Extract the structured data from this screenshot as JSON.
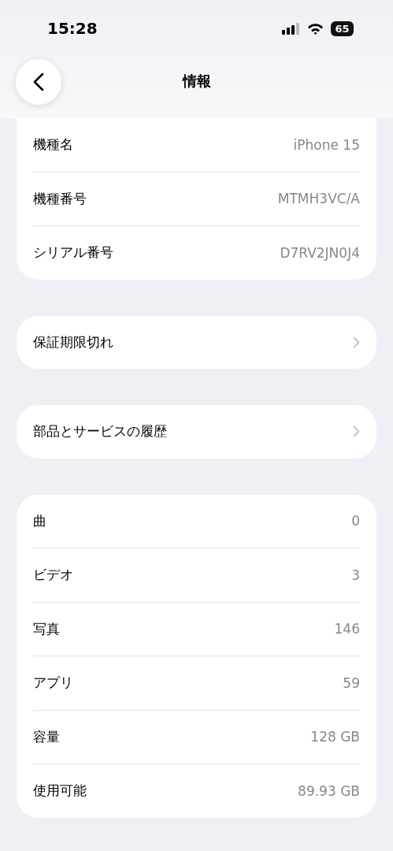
{
  "status_bar": {
    "time": "15:28",
    "battery": "65"
  },
  "nav": {
    "title": "情報"
  },
  "sections": [
    {
      "rows": [
        {
          "label": "機種名",
          "value": "iPhone 15",
          "kind": "value"
        },
        {
          "label": "機種番号",
          "value": "MTMH3VC/A",
          "kind": "value"
        },
        {
          "label": "シリアル番号",
          "value": "D7RV2JN0J4",
          "kind": "value"
        }
      ]
    },
    {
      "rows": [
        {
          "label": "保証期限切れ",
          "kind": "link"
        }
      ]
    },
    {
      "rows": [
        {
          "label": "部品とサービスの履歴",
          "kind": "link"
        }
      ]
    },
    {
      "rows": [
        {
          "label": "曲",
          "value": "0",
          "kind": "value"
        },
        {
          "label": "ビデオ",
          "value": "3",
          "kind": "value"
        },
        {
          "label": "写真",
          "value": "146",
          "kind": "value"
        },
        {
          "label": "アプリ",
          "value": "59",
          "kind": "value"
        },
        {
          "label": "容量",
          "value": "128 GB",
          "kind": "value"
        },
        {
          "label": "使用可能",
          "value": "89.93 GB",
          "kind": "value"
        }
      ]
    }
  ]
}
